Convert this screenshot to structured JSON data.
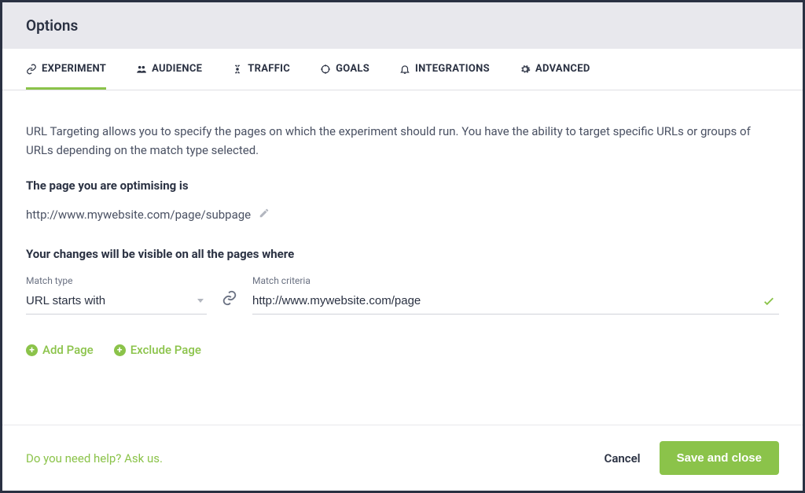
{
  "header": {
    "title": "Options"
  },
  "tabs": [
    {
      "label": "EXPERIMENT",
      "icon": "link-icon"
    },
    {
      "label": "AUDIENCE",
      "icon": "people-icon"
    },
    {
      "label": "TRAFFIC",
      "icon": "target-icon"
    },
    {
      "label": "GOALS",
      "icon": "crosshair-icon"
    },
    {
      "label": "INTEGRATIONS",
      "icon": "bell-icon"
    },
    {
      "label": "ADVANCED",
      "icon": "gear-icon"
    }
  ],
  "experiment": {
    "intro": "URL Targeting allows you to specify the pages on which the experiment should run. You have the ability to target specific URLs or groups of URLs depending on the match type selected.",
    "optimising_label": "The page you are optimising is",
    "optimising_url": "http://www.mywebsite.com/page/subpage",
    "visible_label": "Your changes will be visible on all the pages where",
    "match_type_label": "Match type",
    "match_type_value": "URL starts with",
    "match_criteria_label": "Match criteria",
    "match_criteria_value": "http://www.mywebsite.com/page",
    "add_page": "Add Page",
    "exclude_page": "Exclude Page"
  },
  "footer": {
    "help": "Do you need help? Ask us.",
    "cancel": "Cancel",
    "save": "Save and close"
  },
  "colors": {
    "accent": "#8bc34a"
  }
}
